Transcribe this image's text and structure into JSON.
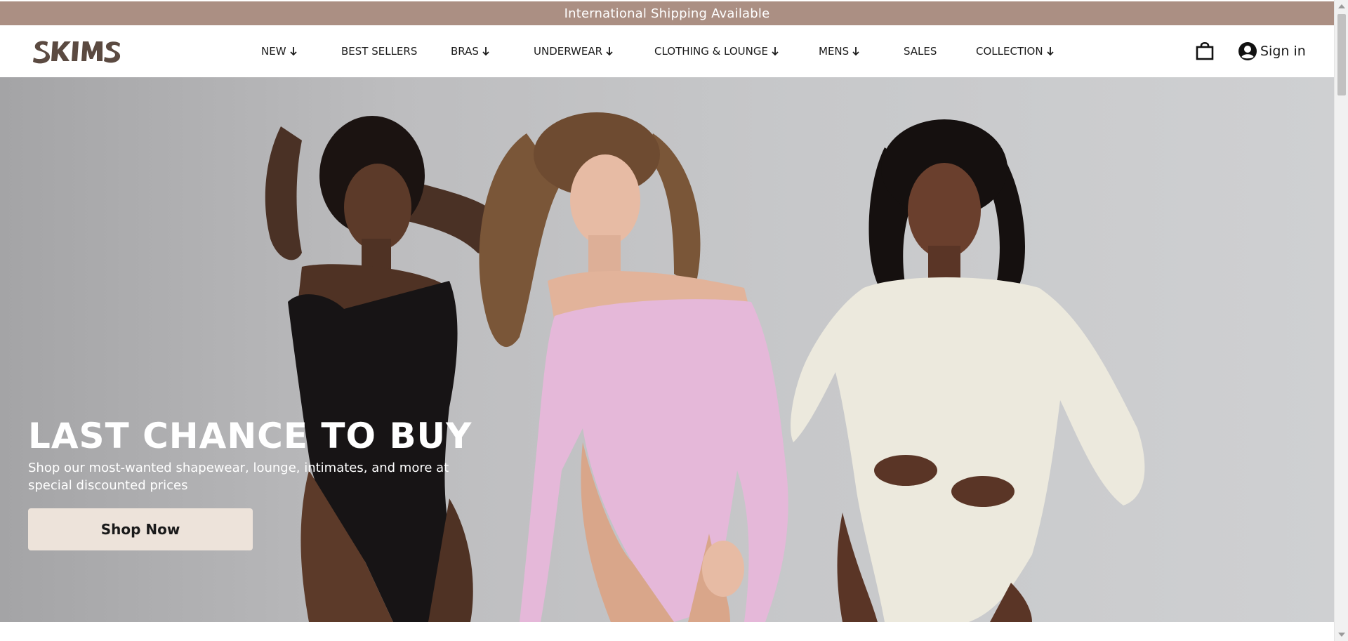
{
  "announcement": {
    "text": "International Shipping Available",
    "background": "#ab8f83"
  },
  "header": {
    "logo_text": "SKIMS",
    "logo_color": "#5b4a41",
    "nav": [
      {
        "label": "NEW",
        "has_dropdown": true
      },
      {
        "label": "BEST SELLERS",
        "has_dropdown": false
      },
      {
        "label": "BRAS",
        "has_dropdown": true
      },
      {
        "label": "UNDERWEAR",
        "has_dropdown": true
      },
      {
        "label": "CLOTHING & LOUNGE",
        "has_dropdown": true
      },
      {
        "label": "MENS",
        "has_dropdown": true
      },
      {
        "label": "SALES",
        "has_dropdown": false
      },
      {
        "label": "COLLECTION",
        "has_dropdown": true
      }
    ],
    "cart_icon": "shopping-bag-icon",
    "account_icon": "user-circle-icon",
    "signin_label": "Sign in"
  },
  "hero": {
    "title": "LAST CHANCE TO BUY",
    "subtitle": "Shop our most-wanted shapewear, lounge, intimates, and more at special discounted prices",
    "cta_label": "Shop Now",
    "cta_background": "#ede3da",
    "image_description_icon": "three-models-bodysuits-image"
  }
}
